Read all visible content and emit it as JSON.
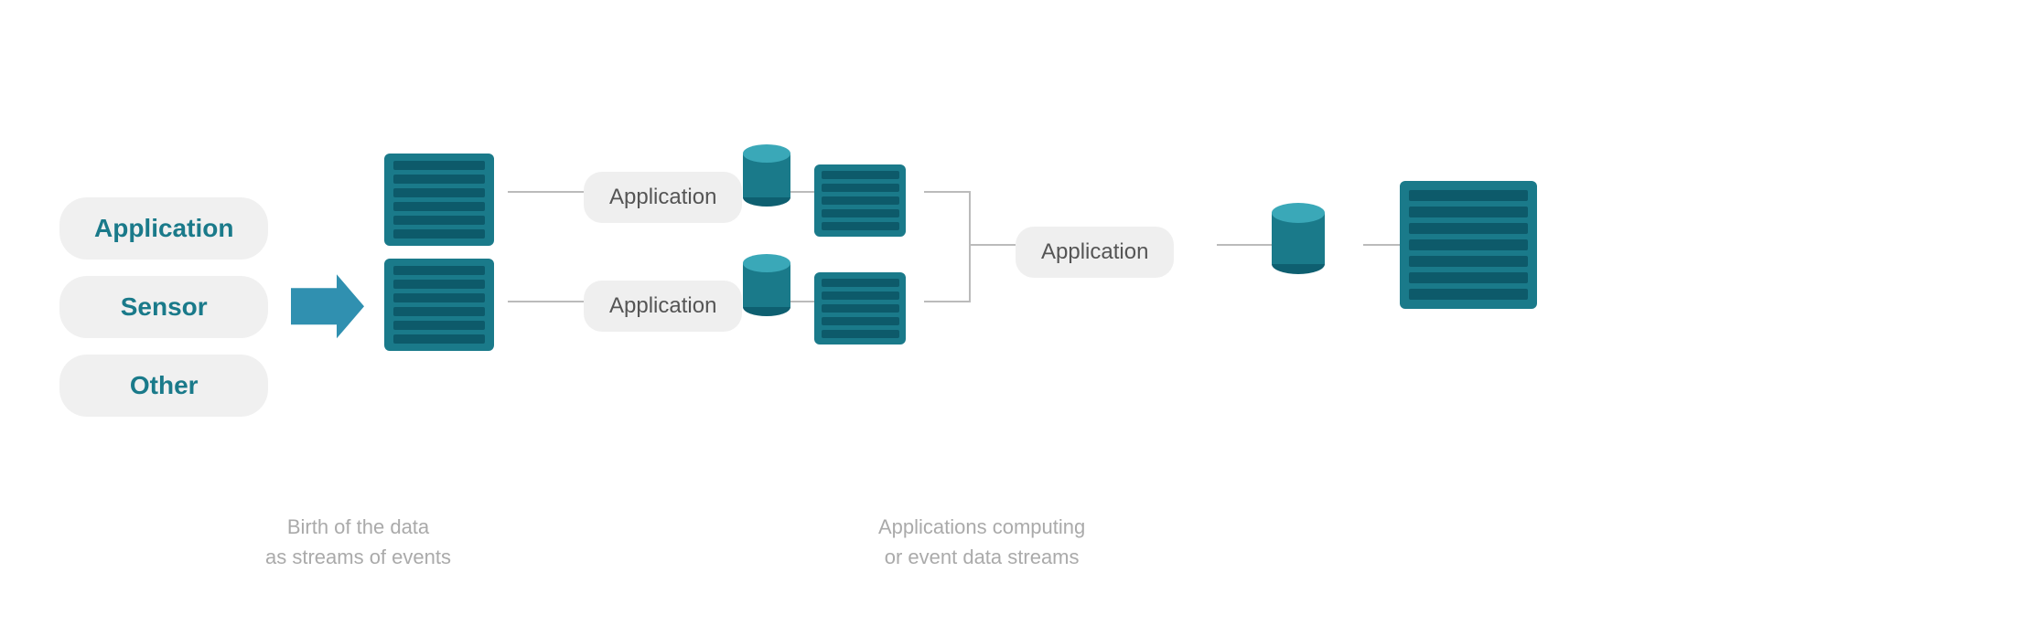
{
  "sources": [
    {
      "label": "Application"
    },
    {
      "label": "Sensor"
    },
    {
      "label": "Other"
    }
  ],
  "nodes": {
    "app_top": "Application",
    "app_bottom": "Application",
    "app_right": "Application"
  },
  "bottom_labels": {
    "left": "Birth of the data\nas streams of events",
    "right": "Applications computing\nor event data streams"
  },
  "colors": {
    "teal": "#1a7a8a",
    "teal_light": "#3aa8b8",
    "arrow": "#3090b0",
    "pill_bg": "#f0f0f0",
    "app_pill_bg": "#efefef",
    "text_source": "#1a7a8a",
    "text_app": "#888888",
    "text_label": "#aaaaaa"
  }
}
